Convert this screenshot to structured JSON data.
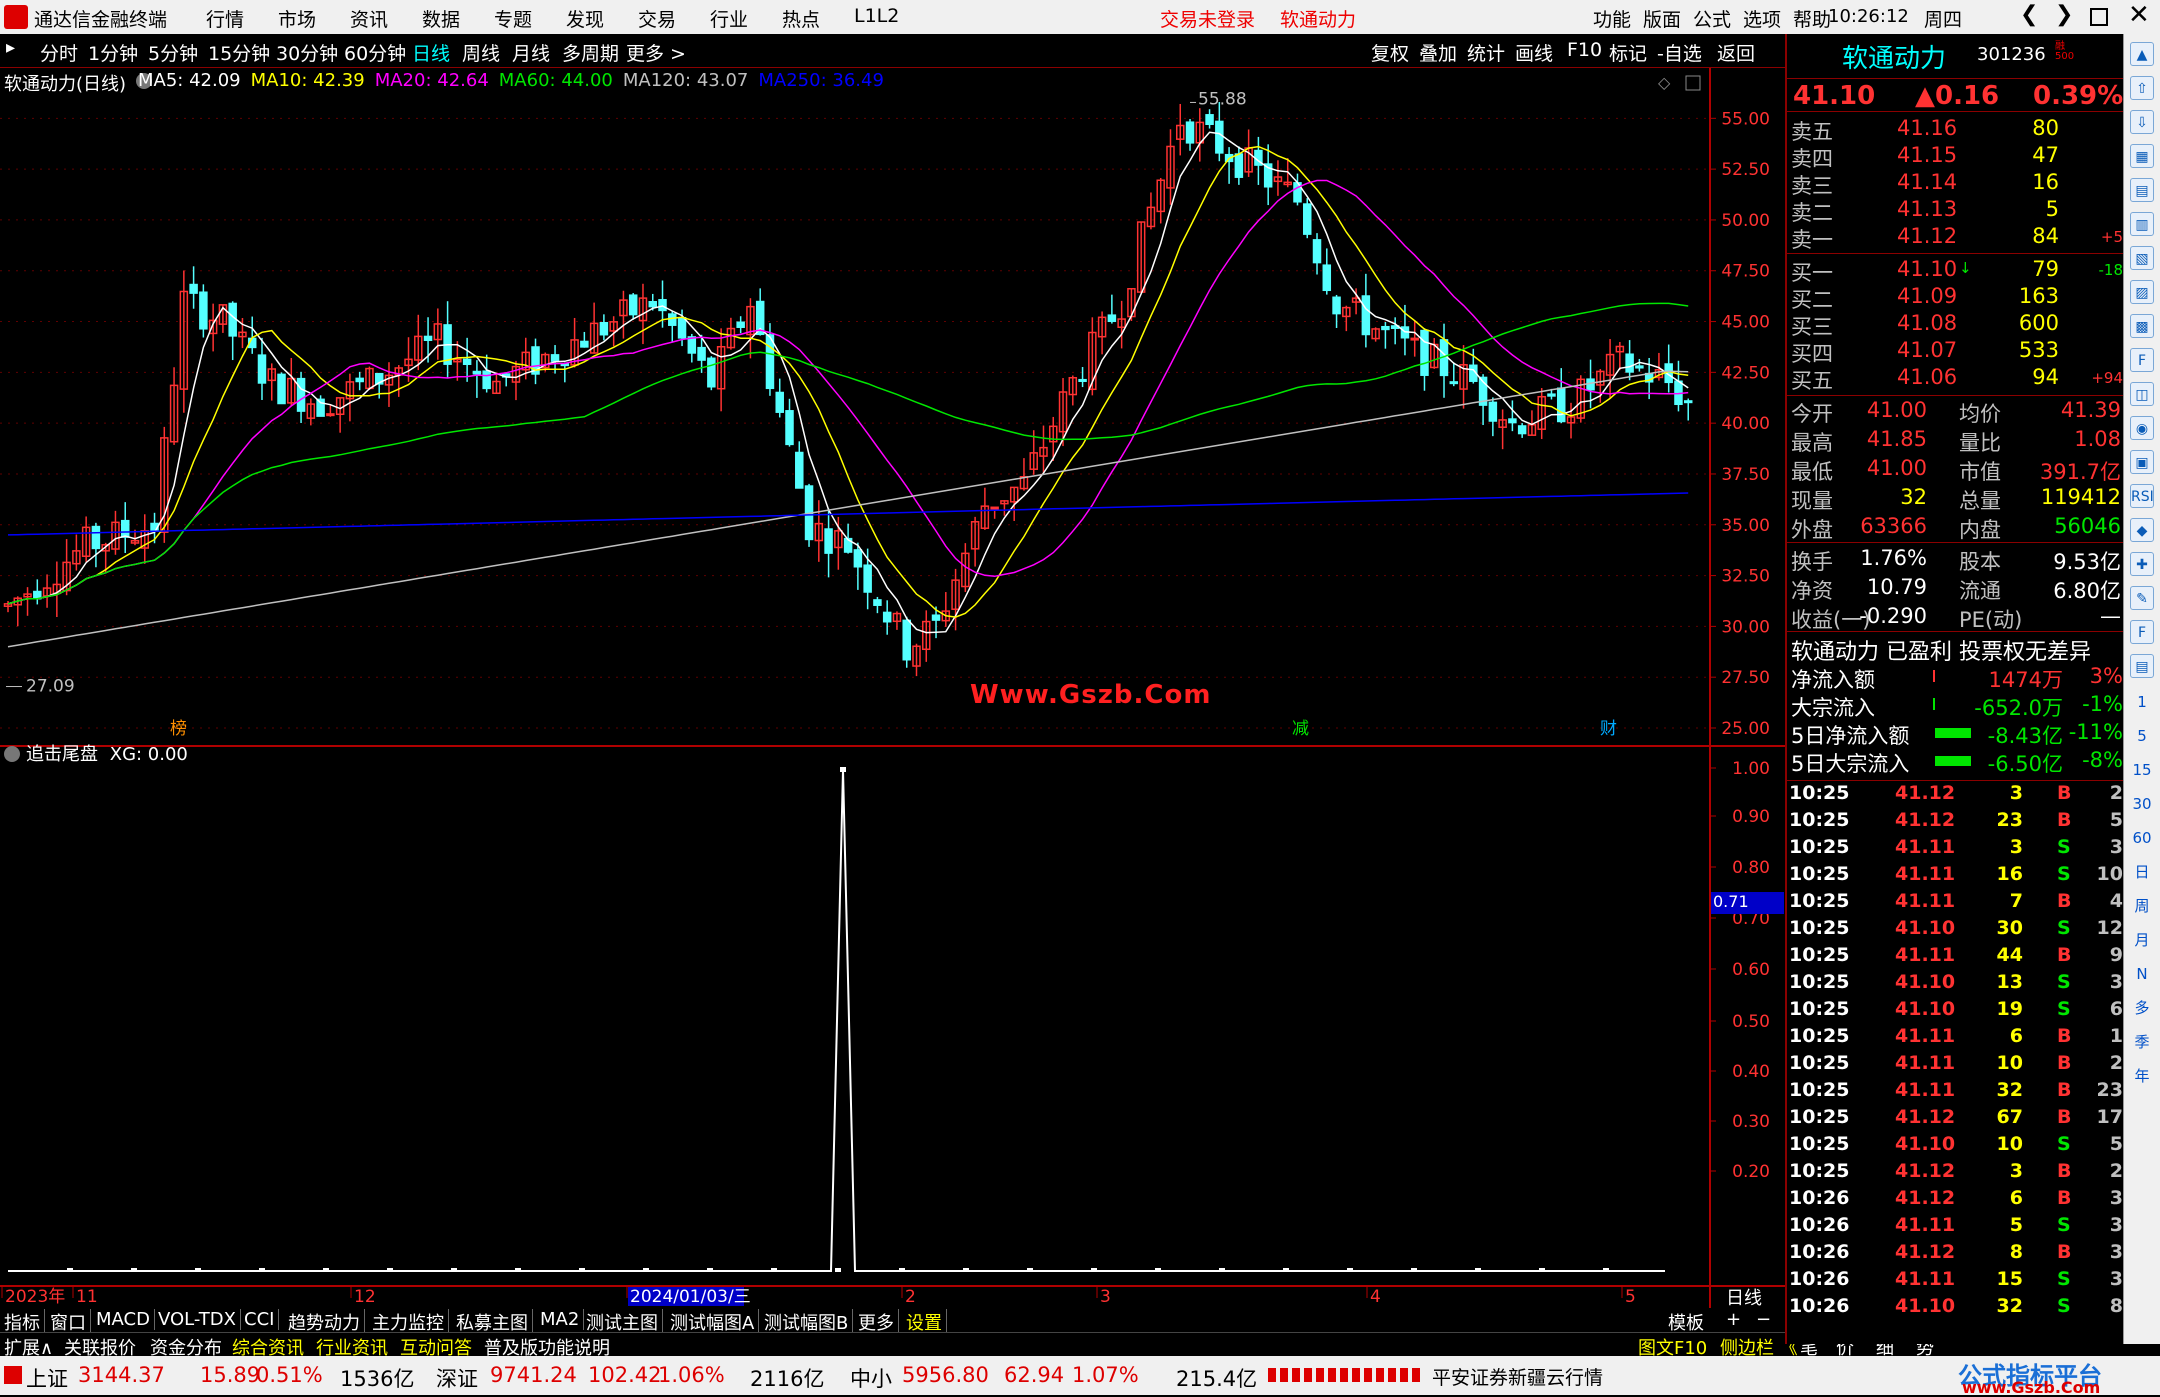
{
  "app": {
    "title": "通达信金融终端",
    "menu": [
      "行情",
      "市场",
      "资讯",
      "数据",
      "专题",
      "发现",
      "交易",
      "行业",
      "热点",
      "L1L2"
    ],
    "login_status": "交易未登录",
    "stock_title": "软通动力",
    "right_menu": [
      "功能",
      "版面",
      "公式",
      "选项",
      "帮助"
    ],
    "time": "10:26:12",
    "weekday": "周四"
  },
  "period_tabs": [
    "分时",
    "1分钟",
    "5分钟",
    "15分钟",
    "30分钟",
    "60分钟",
    "日线",
    "周线",
    "月线",
    "多周期",
    "更多 >"
  ],
  "active_period": "日线",
  "tool_tabs": [
    "复权",
    "叠加",
    "统计",
    "画线",
    "F10",
    "标记",
    "-自选",
    "返回"
  ],
  "chart": {
    "header_name": "软通动力(日线)",
    "ma_labels": [
      {
        "text": "MA5: 42.09",
        "color": "#ffffff"
      },
      {
        "text": "MA10: 42.39",
        "color": "#ffff00"
      },
      {
        "text": "MA20: 42.64",
        "color": "#ff00ff"
      },
      {
        "text": "MA60: 44.00",
        "color": "#00e600"
      },
      {
        "text": "MA120: 43.07",
        "color": "#c0c0c0"
      },
      {
        "text": "MA250: 36.49",
        "color": "#0000ff"
      }
    ],
    "price_ticks": [
      "55.00",
      "52.50",
      "50.00",
      "47.50",
      "45.00",
      "42.50",
      "40.00",
      "37.50",
      "35.00",
      "32.50",
      "30.00",
      "27.50",
      "25.00"
    ],
    "high_label": "55.88",
    "low_label": "27.09",
    "watermark": "Www.Gszb.Com",
    "markers": [
      "榜",
      "减",
      "财"
    ],
    "indicator_header": "追击尾盘",
    "indicator_value": "XG: 0.00",
    "indicator_ticks": [
      "1.00",
      "0.90",
      "0.80",
      "0.70",
      "0.60",
      "0.50",
      "0.40",
      "0.30",
      "0.20"
    ],
    "indicator_cursor": "0.71",
    "date_labels": [
      "2023年",
      "11",
      "12",
      "2024/01/03/三",
      "2",
      "3",
      "4",
      "5"
    ],
    "period_label": "日线"
  },
  "chart_data": {
    "type": "candlestick",
    "ylim": [
      25,
      56
    ],
    "high": 55.88,
    "low": 27.09,
    "indicator_signal_index": 130
  },
  "quote": {
    "name": "软通动力",
    "code": "301236",
    "price": "41.10",
    "change": "▲0.16",
    "pct": "0.39%",
    "asks": [
      {
        "label": "卖五",
        "price": "41.16",
        "vol": "80",
        "chg": ""
      },
      {
        "label": "卖四",
        "price": "41.15",
        "vol": "47",
        "chg": ""
      },
      {
        "label": "卖三",
        "price": "41.14",
        "vol": "16",
        "chg": ""
      },
      {
        "label": "卖二",
        "price": "41.13",
        "vol": "5",
        "chg": ""
      },
      {
        "label": "卖一",
        "price": "41.12",
        "vol": "84",
        "chg": "+5"
      }
    ],
    "bids": [
      {
        "label": "买一",
        "price": "41.10",
        "vol": "79",
        "chg": "-18"
      },
      {
        "label": "买二",
        "price": "41.09",
        "vol": "163",
        "chg": ""
      },
      {
        "label": "买三",
        "price": "41.08",
        "vol": "600",
        "chg": ""
      },
      {
        "label": "买四",
        "price": "41.07",
        "vol": "533",
        "chg": ""
      },
      {
        "label": "买五",
        "price": "41.06",
        "vol": "94",
        "chg": "+94"
      }
    ],
    "stats": [
      {
        "l1": "今开",
        "v1": "41.00",
        "l2": "均价",
        "v2": "41.39"
      },
      {
        "l1": "最高",
        "v1": "41.85",
        "l2": "量比",
        "v2": "1.08"
      },
      {
        "l1": "最低",
        "v1": "41.00",
        "l2": "市值",
        "v2": "391.7亿"
      },
      {
        "l1": "现量",
        "v1": "32",
        "l2": "总量",
        "v2": "119412"
      },
      {
        "l1": "外盘",
        "v1": "63366",
        "l2": "内盘",
        "v2": "56046"
      }
    ],
    "stats2": [
      {
        "l1": "换手",
        "v1": "1.76%",
        "l2": "股本",
        "v2": "9.53亿"
      },
      {
        "l1": "净资",
        "v1": "10.79",
        "l2": "流通",
        "v2": "6.80亿"
      },
      {
        "l1": "收益(一)",
        "v1": "-0.290",
        "l2": "PE(动)",
        "v2": "—"
      }
    ],
    "tagline": "软通动力 已盈利 投票权无差异",
    "flows": [
      {
        "label": "净流入额",
        "value": "1474万",
        "pct": "3%"
      },
      {
        "label": "大宗流入",
        "value": "-652.0万",
        "pct": "-1%"
      },
      {
        "label": "5日净流入额",
        "value": "-8.43亿",
        "pct": "-11%"
      },
      {
        "label": "5日大宗流入",
        "value": "-6.50亿",
        "pct": "-8%"
      }
    ],
    "ticks": [
      [
        "10:25",
        "41.12",
        "3",
        "B",
        "2"
      ],
      [
        "10:25",
        "41.12",
        "23",
        "B",
        "5"
      ],
      [
        "10:25",
        "41.11",
        "3",
        "S",
        "3"
      ],
      [
        "10:25",
        "41.11",
        "16",
        "S",
        "10"
      ],
      [
        "10:25",
        "41.11",
        "7",
        "B",
        "4"
      ],
      [
        "10:25",
        "41.10",
        "30",
        "S",
        "12"
      ],
      [
        "10:25",
        "41.11",
        "44",
        "B",
        "9"
      ],
      [
        "10:25",
        "41.10",
        "13",
        "S",
        "3"
      ],
      [
        "10:25",
        "41.10",
        "19",
        "S",
        "6"
      ],
      [
        "10:25",
        "41.11",
        "6",
        "B",
        "1"
      ],
      [
        "10:25",
        "41.11",
        "10",
        "B",
        "2"
      ],
      [
        "10:25",
        "41.11",
        "32",
        "B",
        "23"
      ],
      [
        "10:25",
        "41.12",
        "67",
        "B",
        "17"
      ],
      [
        "10:25",
        "41.10",
        "10",
        "S",
        "5"
      ],
      [
        "10:25",
        "41.12",
        "3",
        "B",
        "2"
      ],
      [
        "10:26",
        "41.12",
        "6",
        "B",
        "3"
      ],
      [
        "10:26",
        "41.11",
        "5",
        "S",
        "3"
      ],
      [
        "10:26",
        "41.12",
        "8",
        "B",
        "3"
      ],
      [
        "10:26",
        "41.11",
        "15",
        "S",
        "3"
      ],
      [
        "10:26",
        "41.10",
        "32",
        "S",
        "8"
      ]
    ]
  },
  "bottom_tabs": [
    "指标",
    "窗口",
    "MACD",
    "VOL-TDX",
    "CCI",
    "趋势动力",
    "主力监控",
    "私募主图",
    "MA2",
    "测试主图",
    "测试幅图A",
    "测试幅图B",
    "更多",
    "设置"
  ],
  "bottom_right": [
    "模板",
    "+",
    "−"
  ],
  "row2": [
    "扩展∧",
    "关联报价",
    "资金分布",
    "综合资讯",
    "行业资讯",
    "互动问答",
    "普及版功能说明"
  ],
  "row2_right": [
    "图文F10",
    "侧边栏 《",
    "笔",
    "价",
    "细",
    "势"
  ],
  "status": {
    "sh_name": "上证",
    "sh": "3144.37",
    "sh_chg": "15.89",
    "sh_pct": "0.51%",
    "sh_amt": "1536亿",
    "sz_name": "深证",
    "sz": "9741.24",
    "sz_chg": "102.42",
    "sz_pct": "1.06%",
    "sz_amt": "2116亿",
    "zx_name": "中小",
    "zx": "5956.80",
    "zx_chg": "62.94",
    "zx_pct": "1.07%",
    "zx_amt": "215.4亿",
    "broker": "平安证券新疆云行情",
    "brand": "公式指标平台",
    "brand_url": "www.Gszb.Com"
  },
  "side_tools": [
    "▲",
    "⇧",
    "⇩",
    "▦",
    "▤",
    "▥",
    "▧",
    "▨",
    "▩",
    "F",
    "◫",
    "◉",
    "▣",
    "RSI",
    "◆",
    "✚",
    "✎",
    "F",
    "▤",
    "1",
    "5",
    "15",
    "30",
    "60",
    "日",
    "周",
    "月",
    "N",
    "多",
    "季",
    "年"
  ]
}
